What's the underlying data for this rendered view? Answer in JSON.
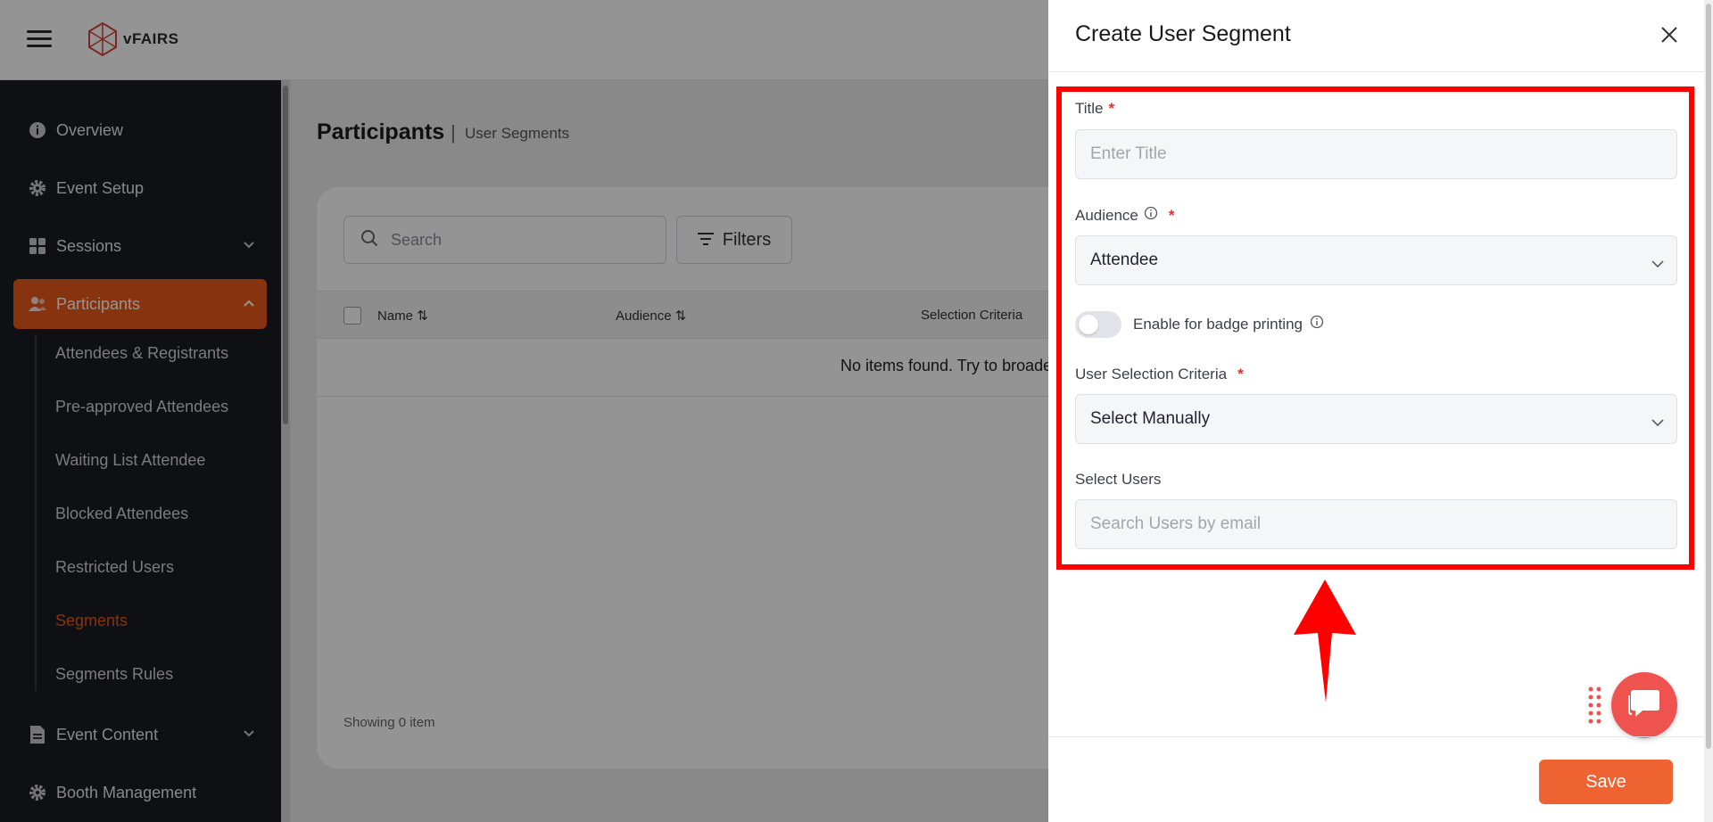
{
  "app": {
    "brand": "vFAIRS"
  },
  "sidebar": {
    "items": [
      {
        "label": "Overview",
        "icon": "info-circle-icon"
      },
      {
        "label": "Event Setup",
        "icon": "gear-icon"
      },
      {
        "label": "Sessions",
        "icon": "grid-icon"
      },
      {
        "label": "Participants",
        "icon": "users-icon"
      },
      {
        "label": "Event Content",
        "icon": "document-icon"
      },
      {
        "label": "Booth Management",
        "icon": "gear-icon"
      }
    ],
    "sub_items": [
      "Attendees & Registrants",
      "Pre-approved Attendees",
      "Waiting List Attendee",
      "Blocked Attendees",
      "Restricted Users",
      "Segments",
      "Segments Rules"
    ],
    "active_item": "Participants",
    "active_sub_item": "Segments",
    "accent_color": "#e8591a"
  },
  "main": {
    "title": "Participants",
    "separator": "|",
    "subtitle": "User Segments",
    "search_placeholder": "Search",
    "filters_label": "Filters",
    "columns": [
      "Name",
      "Audience",
      "Selection Criteria"
    ],
    "empty_message": "No items found. Try to broade",
    "showing": "Showing 0 item"
  },
  "drawer": {
    "title": "Create User Segment",
    "title_field": {
      "label": "Title",
      "required_mark": "*",
      "placeholder": "Enter Title"
    },
    "audience_field": {
      "label": "Audience",
      "required_mark": "*",
      "value": "Attendee"
    },
    "badge_toggle": {
      "label": "Enable for badge printing",
      "enabled": false
    },
    "criteria_field": {
      "label": "User Selection Criteria",
      "required_mark": "*",
      "value": "Select Manually"
    },
    "users_field": {
      "label": "Select Users",
      "placeholder": "Search Users by email"
    },
    "save_label": "Save",
    "save_color": "#ef6232",
    "highlight_color": "#ff0000"
  }
}
